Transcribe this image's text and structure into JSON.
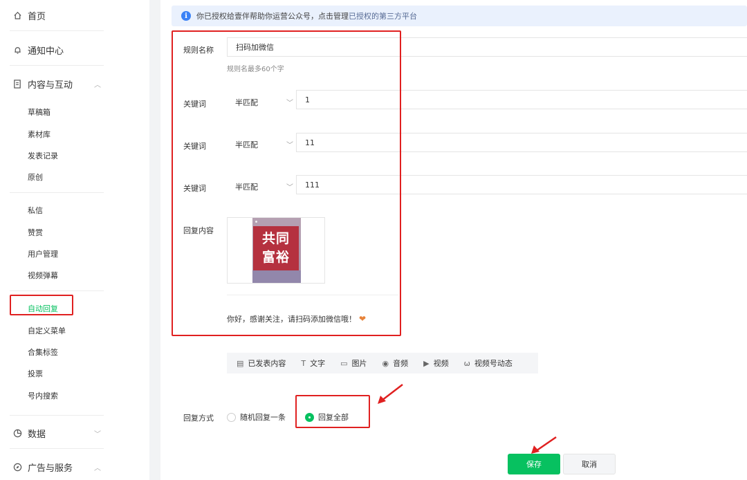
{
  "sidebar": {
    "home": "首页",
    "notifications": "通知中心",
    "content": "内容与互动",
    "content_items": [
      "草稿箱",
      "素材库",
      "发表记录",
      "原创"
    ],
    "interaction_items": [
      "私信",
      "赞赏",
      "用户管理",
      "视频弹幕"
    ],
    "active_item": "自动回复",
    "extra_items": [
      "自定义菜单",
      "合集标签",
      "投票",
      "号内搜索"
    ],
    "data": "数据",
    "ads": "广告与服务"
  },
  "banner": {
    "text": "你已授权给壹伴帮助你运营公众号，点击管理",
    "link": "已授权的第三方平台"
  },
  "form": {
    "rule_name_label": "规则名称",
    "rule_name_value": "扫码加微信",
    "rule_name_hint": "规则名最多60个字",
    "keywords": [
      {
        "label": "关键词",
        "match": "半匹配",
        "value": "1"
      },
      {
        "label": "关键词",
        "match": "半匹配",
        "value": "11"
      },
      {
        "label": "关键词",
        "match": "半匹配",
        "value": "111"
      }
    ],
    "reply_label": "回复内容",
    "reply_image_text": "共同\n富裕",
    "reply_text": "你好，感谢关注，请扫码添加微信哦！",
    "toolbar": [
      "已发表内容",
      "文字",
      "图片",
      "音频",
      "视频",
      "视频号动态"
    ],
    "reply_mode_label": "回复方式",
    "reply_mode_options": [
      "随机回复一条",
      "回复全部"
    ],
    "reply_mode_selected": "回复全部"
  },
  "buttons": {
    "save": "保存",
    "cancel": "取消"
  },
  "colors": {
    "accent": "#07c160",
    "highlight": "#e02020",
    "info": "#3b82f6"
  }
}
